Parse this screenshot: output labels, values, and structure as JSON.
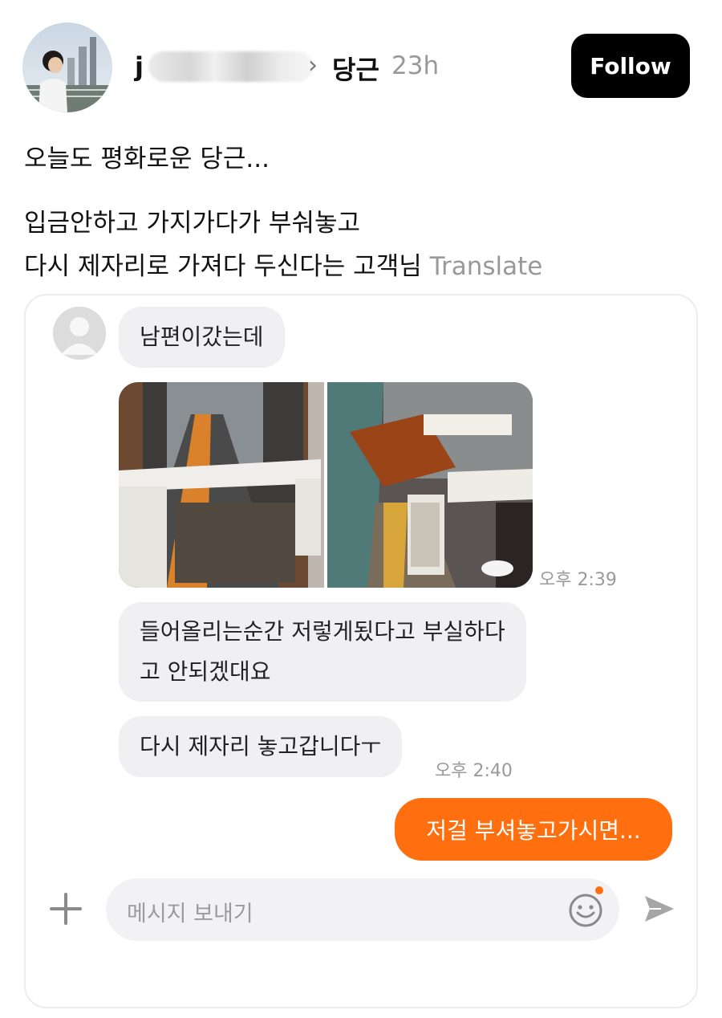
{
  "post": {
    "username_initial": "j",
    "topic": "당근",
    "time_ago": "23h",
    "follow_label": "Follow",
    "title": "오늘도 평화로운 당근...",
    "body_line1": "입금안하고 가지가다가 부숴놓고",
    "body_line2": "다시 제자리로 가져다 두신다는 고객님",
    "translate_label": "Translate"
  },
  "chat": {
    "msg1": "남편이갔는데",
    "photo_time": "오후 2:39",
    "msg2_line1": "들어올리는순간 저렇게됬다고 부실하다",
    "msg2_line2": "고 안되겠대요",
    "msg3": "다시 제자리 놓고갑니다ㅜ",
    "msg3_time": "오후 2:40",
    "my_msg": "저걸 부셔놓고가시면...",
    "input_placeholder": "메시지 보내기"
  },
  "icons": {
    "chevron": "chevron-right-icon",
    "plus": "plus-icon",
    "emoji": "smiley-icon",
    "send": "send-icon"
  },
  "colors": {
    "accent": "#ff6f0f",
    "follow_bg": "#000000",
    "bubble_bg": "#f0f0f2"
  }
}
